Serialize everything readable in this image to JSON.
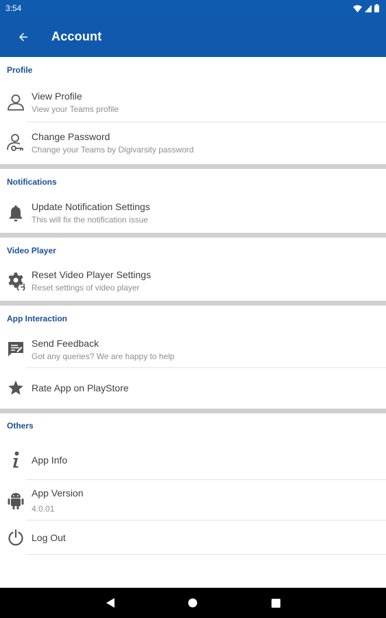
{
  "status_bar": {
    "time": "3:54"
  },
  "app_bar": {
    "title": "Account"
  },
  "sections": {
    "profile": {
      "header": "Profile",
      "view_profile": {
        "title": "View Profile",
        "subtitle": "View your Teams profile"
      },
      "change_password": {
        "title": "Change Password",
        "subtitle": "Change your Teams by Digivarsity password"
      }
    },
    "notifications": {
      "header": "Notifications",
      "update_notification": {
        "title": "Update Notification Settings",
        "subtitle": "This will fix the notification issue"
      }
    },
    "video_player": {
      "header": "Video Player",
      "reset_video": {
        "title": "Reset Video Player Settings",
        "subtitle": "Reset settings of video player"
      }
    },
    "app_interaction": {
      "header": "App Interaction",
      "send_feedback": {
        "title": "Send Feedback",
        "subtitle": "Got any queries? We are happy to help"
      },
      "rate_app": {
        "title": "Rate App on PlayStore"
      }
    },
    "others": {
      "header": "Others",
      "app_info": {
        "title": "App Info"
      },
      "app_version": {
        "title": "App Version",
        "subtitle": "4.0.01"
      },
      "log_out": {
        "title": "Log Out"
      }
    }
  },
  "icons": {
    "back": "arrow-left-icon",
    "view_profile": "person-outline-icon",
    "change_password": "person-key-icon",
    "update_notification": "bell-icon",
    "reset_video": "gear-reset-icon",
    "send_feedback": "feedback-icon",
    "rate_app": "star-icon",
    "app_info": "info-icon",
    "app_version": "android-icon",
    "log_out": "power-icon"
  },
  "colors": {
    "app_bar": "#1159ad",
    "status_bar": "#0f5bb0",
    "section_header": "#1a4f9a",
    "section_divider": "#d0d0d0",
    "icon": "#555555"
  }
}
